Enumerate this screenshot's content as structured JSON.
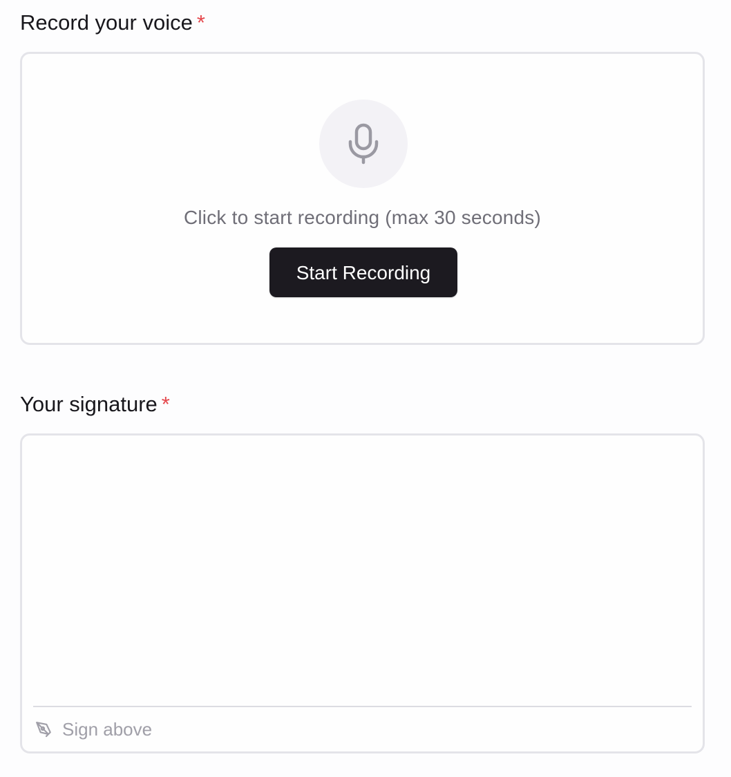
{
  "voice": {
    "label": "Record your voice",
    "required_mark": "*",
    "hint": "Click to start recording (max 30 seconds)",
    "button_label": "Start Recording",
    "icon": "microphone-icon"
  },
  "signature": {
    "label": "Your signature",
    "required_mark": "*",
    "hint": "Sign above",
    "icon": "pen-tool-icon"
  },
  "colors": {
    "required": "#e5484d",
    "button_bg": "#1c1a20",
    "border": "#e4e4e9",
    "muted_text": "#6f6e77"
  }
}
